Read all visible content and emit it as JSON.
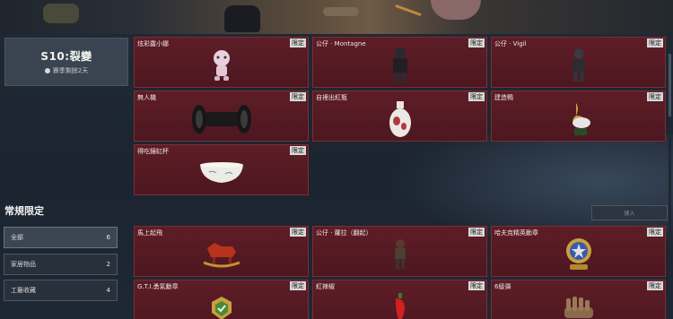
{
  "season": {
    "title": "S10:裂變",
    "subtitle": "賽季剩餘2天"
  },
  "season_items": [
    {
      "name": "炫彩露小娜",
      "tag": "限定",
      "icon": "doll-icon"
    },
    {
      "name": "公仔 · Montagne",
      "tag": "限定",
      "icon": "figure-icon"
    },
    {
      "name": "公仔 · Vigil",
      "tag": "限定",
      "icon": "figure-icon"
    },
    {
      "name": "無人機",
      "tag": "限定",
      "icon": "drone-icon"
    },
    {
      "name": "自裡出紅瓶",
      "tag": "限定",
      "icon": "vase-icon"
    },
    {
      "name": "建造鴨",
      "tag": "限定",
      "icon": "duck-icon"
    },
    {
      "name": "得吃鐘缸杯",
      "tag": "限定",
      "icon": "bowl-icon"
    }
  ],
  "regular": {
    "title": "常規限定",
    "search_placeholder": "搜入",
    "filters": [
      {
        "label": "全部",
        "count": "6"
      },
      {
        "label": "家居物品",
        "count": "2"
      },
      {
        "label": "工藝收藏",
        "count": "4"
      }
    ],
    "items": [
      {
        "name": "馬上起飛",
        "tag": "限定",
        "icon": "rocking-horse-icon"
      },
      {
        "name": "公仔 · 蘿拉（翻起）",
        "tag": "限定",
        "icon": "figure-icon"
      },
      {
        "name": "哈夫克精英勳章",
        "tag": "限定",
        "icon": "medal-icon"
      },
      {
        "name": "G.T.I.勇氣勳章",
        "tag": "限定",
        "icon": "badge-icon"
      },
      {
        "name": "紅辣椒",
        "tag": "限定",
        "icon": "chili-icon"
      },
      {
        "name": "6級彈",
        "tag": "限定",
        "icon": "hand-icon"
      }
    ]
  },
  "colors": {
    "card_bg": "#5e1d26",
    "accent": "#d9d9d9"
  }
}
